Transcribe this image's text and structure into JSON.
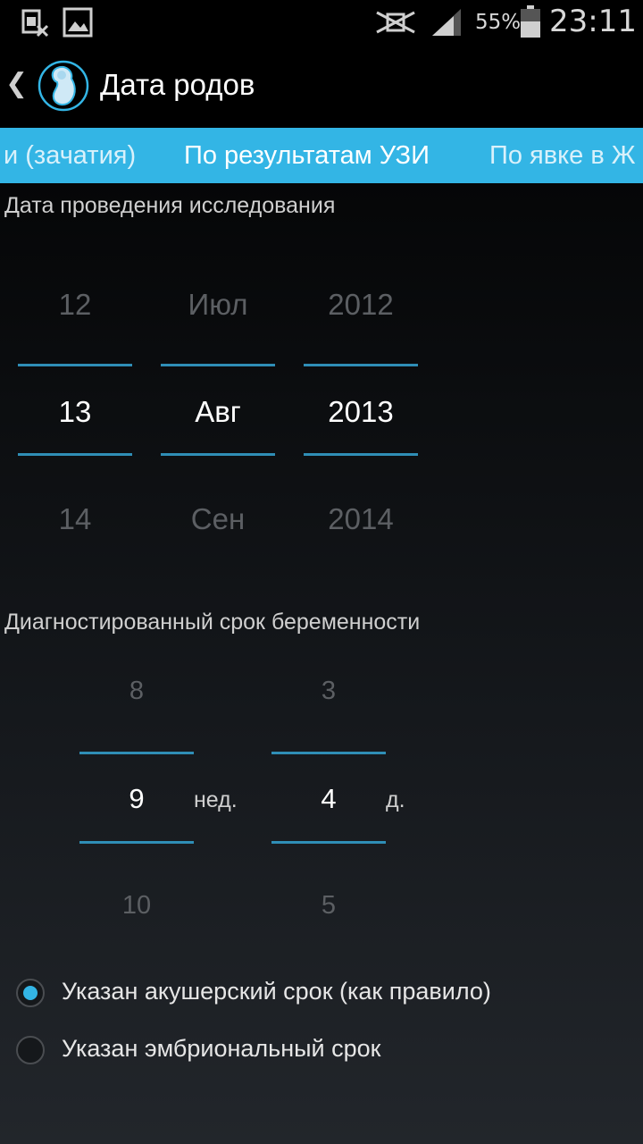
{
  "status_bar": {
    "battery_percent": "55%",
    "time": "23:11",
    "icons": [
      "sim-disabled-icon",
      "image-icon",
      "mute-icon",
      "signal-icon",
      "battery-icon"
    ]
  },
  "action_bar": {
    "back_glyph": "❮",
    "title": "Дата родов",
    "logo_icon": "fetus-logo-icon"
  },
  "tabs": [
    {
      "label": "и (зачатия)",
      "selected": false
    },
    {
      "label": "По результатам УЗИ",
      "selected": true
    },
    {
      "label": "По явке в Ж",
      "selected": false
    }
  ],
  "study_date": {
    "label": "Дата проведения исследования",
    "day": {
      "prev": "12",
      "value": "13",
      "next": "14"
    },
    "month": {
      "prev": "Июл",
      "value": "Авг",
      "next": "Сен"
    },
    "year": {
      "prev": "2012",
      "value": "2013",
      "next": "2014"
    }
  },
  "gestation": {
    "label": "Диагностированный срок беременности",
    "weeks": {
      "prev": "8",
      "value": "9",
      "next": "10",
      "unit": "нед."
    },
    "days": {
      "prev": "3",
      "value": "4",
      "next": "5",
      "unit": "д."
    }
  },
  "radio_options": [
    {
      "label": "Указан акушерский срок (как правило)",
      "checked": true
    },
    {
      "label": "Указан эмбриональный срок",
      "checked": false
    }
  ],
  "colors": {
    "accent": "#33b5e5",
    "picker_line": "#2f8eb6",
    "faded_text": "#5c5f63"
  }
}
